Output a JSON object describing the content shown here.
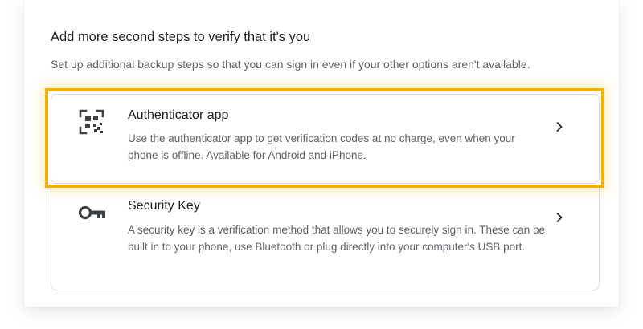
{
  "heading": "Add more second steps to verify that it's you",
  "subheading": "Set up additional backup steps so that you can sign in even if your other options aren't available.",
  "options": [
    {
      "title": "Authenticator app",
      "description": "Use the authenticator app to get verification codes at no charge, even when your phone is offline. Available for Android and iPhone.",
      "icon": "qr-code-icon",
      "highlighted": true
    },
    {
      "title": "Security Key",
      "description": "A security key is a verification method that allows you to securely sign in. These can be built in to your phone, use Bluetooth or plug directly into your computer's USB port.",
      "icon": "key-icon",
      "highlighted": false
    }
  ],
  "colors": {
    "highlight": "#f2b100",
    "title_text": "#202124",
    "secondary_text": "#5f6368",
    "border": "#dadce0"
  }
}
